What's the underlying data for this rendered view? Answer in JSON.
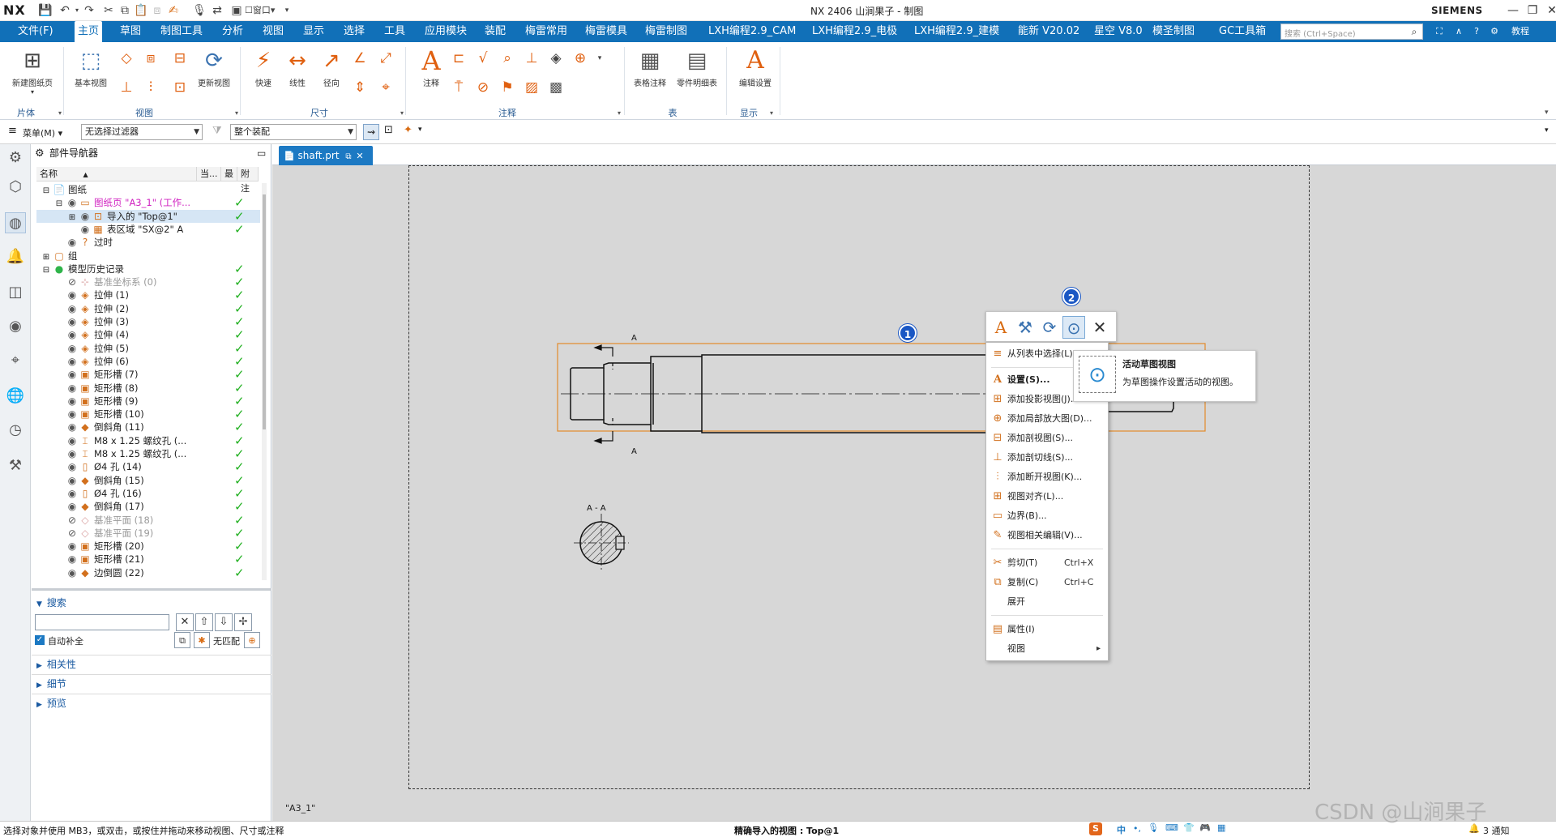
{
  "titlebar": {
    "logo": "NX",
    "title": "NX 2406 山涧果子 - 制图",
    "brand": "SIEMENS",
    "window_menu": "窗口"
  },
  "menubar": {
    "items": [
      "文件(F)",
      "主页",
      "草图",
      "制图工具",
      "分析",
      "视图",
      "显示",
      "选择",
      "工具",
      "应用模块",
      "装配",
      "梅雷常用",
      "梅雷模具",
      "梅雷制图",
      "LXH编程2.9_CAM",
      "LXH编程2.9_电极",
      "LXH编程2.9_建模",
      "能新 V20.02",
      "星空 V8.0",
      "模圣制图",
      "GC工具箱"
    ],
    "active_index": 1,
    "search_placeholder": "搜索 (Ctrl+Space)",
    "tutorial": "教程"
  },
  "ribbon": {
    "new_sheet": "新建图纸页",
    "base_view": "基本视图",
    "update_view": "更新视图",
    "quick": "快速",
    "linear": "线性",
    "radial": "径向",
    "note": "注释",
    "table_note": "表格注释",
    "parts_list": "零件明细表",
    "edit_settings": "编辑设置",
    "groups": [
      "片体",
      "视图",
      "尺寸",
      "注释",
      "表",
      "显示"
    ]
  },
  "filterbar": {
    "menu": "菜单(M)",
    "filter": "无选择过滤器",
    "scope": "整个装配"
  },
  "navigator": {
    "title": "部件导航器",
    "columns": [
      "名称",
      "当...",
      "最",
      "附注"
    ],
    "rows": [
      {
        "indent": 0,
        "toggle": "−",
        "icon": "📄",
        "label": "图纸",
        "style": "",
        "check": false
      },
      {
        "indent": 1,
        "toggle": "−",
        "icon": "▭",
        "label": "图纸页 \"A3_1\" (工作...",
        "style": "pink",
        "check": true
      },
      {
        "indent": 2,
        "toggle": "+",
        "icon": "⊡",
        "label": "导入的 \"Top@1\"",
        "style": "",
        "check": true,
        "selected": true
      },
      {
        "indent": 2,
        "toggle": "",
        "icon": "▦",
        "label": "表区域 \"SX@2\" A",
        "style": "",
        "check": true
      },
      {
        "indent": 1,
        "toggle": "",
        "icon": "?",
        "label": "过时",
        "style": "",
        "check": false
      },
      {
        "indent": 0,
        "toggle": "+",
        "icon": "▢",
        "label": "组",
        "style": "",
        "check": false
      },
      {
        "indent": 0,
        "toggle": "−",
        "icon": "●",
        "label": "模型历史记录",
        "style": "",
        "check": true
      },
      {
        "indent": 1,
        "toggle": "",
        "icon": "⊹",
        "label": "基准坐标系 (0)",
        "style": "grey",
        "check": true
      },
      {
        "indent": 1,
        "toggle": "",
        "icon": "◈",
        "label": "拉伸 (1)",
        "style": "",
        "check": true
      },
      {
        "indent": 1,
        "toggle": "",
        "icon": "◈",
        "label": "拉伸 (2)",
        "style": "",
        "check": true
      },
      {
        "indent": 1,
        "toggle": "",
        "icon": "◈",
        "label": "拉伸 (3)",
        "style": "",
        "check": true
      },
      {
        "indent": 1,
        "toggle": "",
        "icon": "◈",
        "label": "拉伸 (4)",
        "style": "",
        "check": true
      },
      {
        "indent": 1,
        "toggle": "",
        "icon": "◈",
        "label": "拉伸 (5)",
        "style": "",
        "check": true
      },
      {
        "indent": 1,
        "toggle": "",
        "icon": "◈",
        "label": "拉伸 (6)",
        "style": "",
        "check": true
      },
      {
        "indent": 1,
        "toggle": "",
        "icon": "▣",
        "label": "矩形槽 (7)",
        "style": "",
        "check": true
      },
      {
        "indent": 1,
        "toggle": "",
        "icon": "▣",
        "label": "矩形槽 (8)",
        "style": "",
        "check": true
      },
      {
        "indent": 1,
        "toggle": "",
        "icon": "▣",
        "label": "矩形槽 (9)",
        "style": "",
        "check": true
      },
      {
        "indent": 1,
        "toggle": "",
        "icon": "▣",
        "label": "矩形槽 (10)",
        "style": "",
        "check": true
      },
      {
        "indent": 1,
        "toggle": "",
        "icon": "◆",
        "label": "倒斜角 (11)",
        "style": "",
        "check": true
      },
      {
        "indent": 1,
        "toggle": "",
        "icon": "⌶",
        "label": "M8 x 1.25 螺纹孔 (...",
        "style": "",
        "check": true
      },
      {
        "indent": 1,
        "toggle": "",
        "icon": "⌶",
        "label": "M8 x 1.25 螺纹孔 (...",
        "style": "",
        "check": true
      },
      {
        "indent": 1,
        "toggle": "",
        "icon": "▯",
        "label": "Ø4 孔 (14)",
        "style": "",
        "check": true
      },
      {
        "indent": 1,
        "toggle": "",
        "icon": "◆",
        "label": "倒斜角 (15)",
        "style": "",
        "check": true
      },
      {
        "indent": 1,
        "toggle": "",
        "icon": "▯",
        "label": "Ø4 孔 (16)",
        "style": "",
        "check": true
      },
      {
        "indent": 1,
        "toggle": "",
        "icon": "◆",
        "label": "倒斜角 (17)",
        "style": "",
        "check": true
      },
      {
        "indent": 1,
        "toggle": "",
        "icon": "◇",
        "label": "基准平面 (18)",
        "style": "grey",
        "check": true
      },
      {
        "indent": 1,
        "toggle": "",
        "icon": "◇",
        "label": "基准平面 (19)",
        "style": "grey",
        "check": true
      },
      {
        "indent": 1,
        "toggle": "",
        "icon": "▣",
        "label": "矩形槽 (20)",
        "style": "",
        "check": true
      },
      {
        "indent": 1,
        "toggle": "",
        "icon": "▣",
        "label": "矩形槽 (21)",
        "style": "",
        "check": true
      },
      {
        "indent": 1,
        "toggle": "",
        "icon": "◆",
        "label": "边倒圆 (22)",
        "style": "",
        "check": true
      }
    ],
    "search_label": "搜索",
    "autocomplete": "自动补全",
    "no_match": "无匹配",
    "sections": [
      "相关性",
      "细节",
      "预览"
    ]
  },
  "doc_tab": "shaft.prt",
  "sheet_name": "\"A3_1\"",
  "drawing": {
    "section_label_top": "A",
    "section_label_bottom": "A",
    "section_view_label": "A - A"
  },
  "context_menu": {
    "badge1": "1",
    "badge2": "2",
    "items": [
      {
        "label": "从列表中选择(L)",
        "icon": "≡",
        "shortcut": ""
      },
      {
        "label": "设置(S)...",
        "icon": "A",
        "shortcut": "",
        "bold": true
      },
      {
        "label": "添加投影视图(J)...",
        "icon": "⊞",
        "shortcut": ""
      },
      {
        "label": "添加局部放大图(D)...",
        "icon": "⊕",
        "shortcut": ""
      },
      {
        "label": "添加剖视图(S)...",
        "icon": "⊟",
        "shortcut": ""
      },
      {
        "label": "添加剖切线(S)...",
        "icon": "⊥",
        "shortcut": ""
      },
      {
        "label": "添加断开视图(K)...",
        "icon": "⫶",
        "shortcut": ""
      },
      {
        "label": "视图对齐(L)...",
        "icon": "⊞",
        "shortcut": ""
      },
      {
        "label": "边界(B)...",
        "icon": "▭",
        "shortcut": ""
      },
      {
        "label": "视图相关编辑(V)...",
        "icon": "✎",
        "shortcut": ""
      },
      {
        "label": "剪切(T)",
        "icon": "✂",
        "shortcut": "Ctrl+X"
      },
      {
        "label": "复制(C)",
        "icon": "⧉",
        "shortcut": "Ctrl+C"
      },
      {
        "label": "展开",
        "icon": "",
        "shortcut": ""
      },
      {
        "label": "属性(I)",
        "icon": "▤",
        "shortcut": ""
      },
      {
        "label": "视图",
        "icon": "",
        "shortcut": "▸"
      }
    ]
  },
  "tooltip": {
    "title": "活动草图视图",
    "body": "为草图操作设置活动的视图。"
  },
  "status": {
    "left": "选择对象并使用 MB3，或双击，或按住并拖动来移动视图、尺寸或注释",
    "mid": "精确导入的视图 : Top@1",
    "notify": "3 通知",
    "ime": "中"
  },
  "watermark": "CSDN @山涧果子",
  "colors": {
    "menubar": "#1170b8",
    "accent_orange": "#e06010",
    "check_green": "#22b021",
    "badge_blue": "#1a57c4"
  }
}
